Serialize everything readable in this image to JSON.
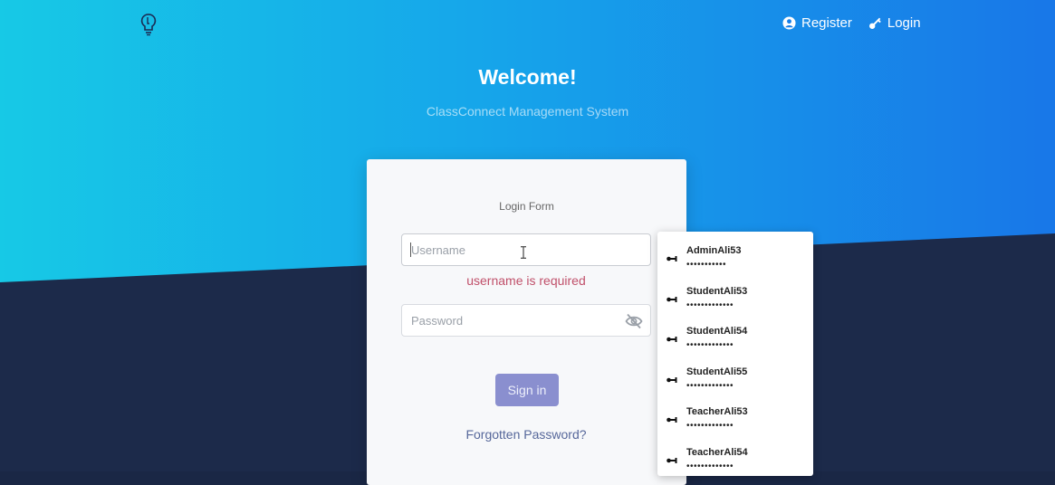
{
  "nav": {
    "logo_icon": "lightbulb-icon",
    "register_label": "Register",
    "register_icon": "user-circle-icon",
    "login_label": "Login",
    "login_icon": "key-icon"
  },
  "hero": {
    "title": "Welcome!",
    "subtitle": "ClassConnect Management System"
  },
  "form": {
    "title": "Login Form",
    "username": {
      "value": "",
      "placeholder": "Username"
    },
    "username_error": "username is required",
    "password": {
      "value": "",
      "placeholder": "Password"
    },
    "password_toggle_icon": "eye-slash-icon",
    "signin_label": "Sign in",
    "forgot_label": "Forgotten Password?"
  },
  "autofill": {
    "key_icon": "key-icon",
    "items": [
      {
        "username": "AdminAli53",
        "password": "•••••••••••"
      },
      {
        "username": "StudentAli53",
        "password": "•••••••••••••"
      },
      {
        "username": "StudentAli54",
        "password": "•••••••••••••"
      },
      {
        "username": "StudentAli55",
        "password": "•••••••••••••"
      },
      {
        "username": "TeacherAli53",
        "password": "•••••••••••••"
      },
      {
        "username": "TeacherAli54",
        "password": "•••••••••••••"
      }
    ]
  },
  "colors": {
    "gradient_start": "#17c9e6",
    "gradient_end": "#1877e8",
    "dark_band": "#1a2745",
    "error": "#c0506a",
    "signin_button": "#8a8fcf",
    "link": "#56679a"
  }
}
